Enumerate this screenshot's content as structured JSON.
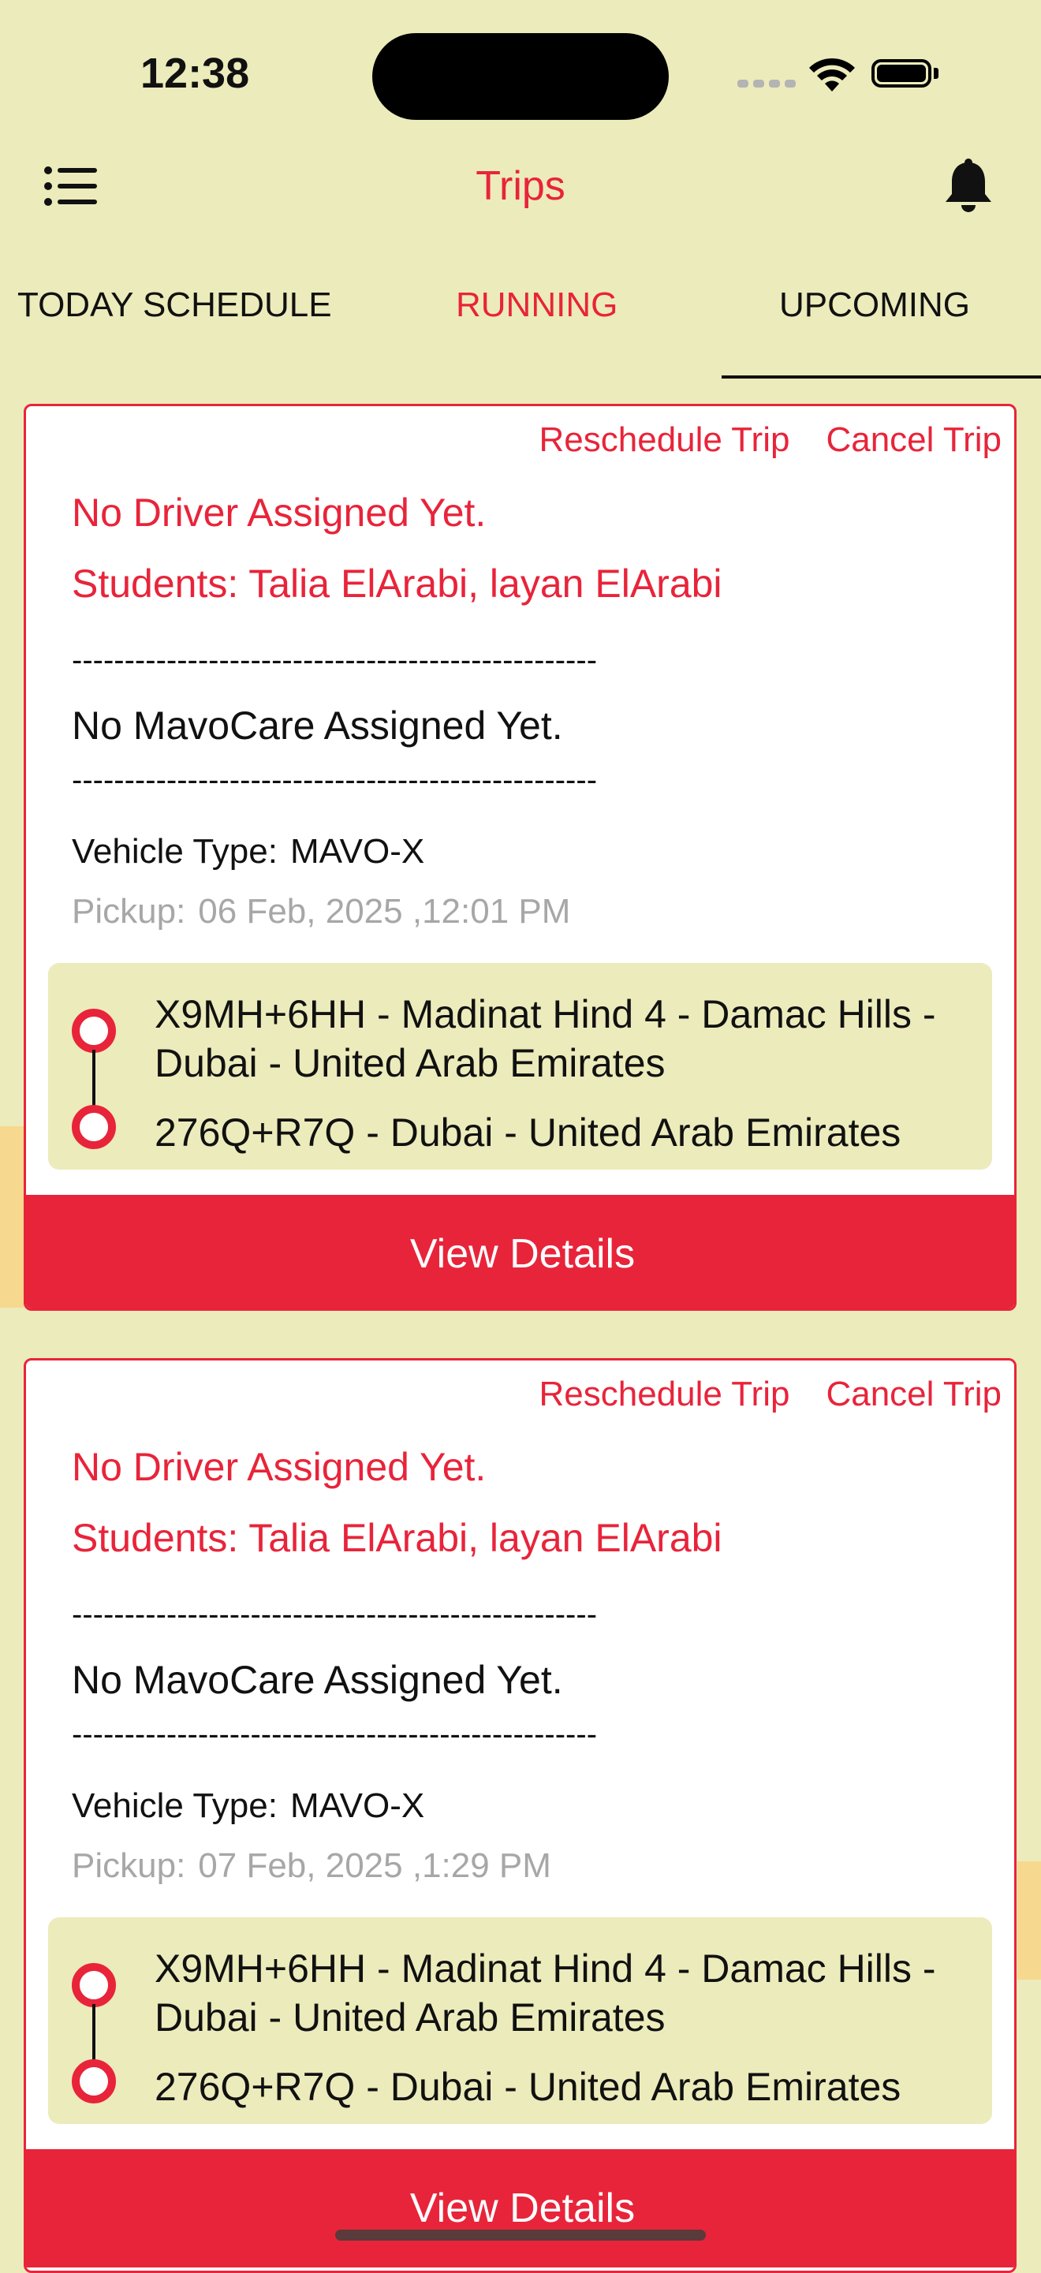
{
  "status_bar": {
    "time": "12:38"
  },
  "nav": {
    "title": "Trips",
    "menu_icon": "menu-list-icon",
    "bell_icon": "bell-icon"
  },
  "tabs": [
    {
      "label": "TODAY SCHEDULE",
      "selected": false
    },
    {
      "label": "RUNNING",
      "selected": false
    },
    {
      "label": "UPCOMING",
      "selected": true
    }
  ],
  "colors": {
    "accent": "#e8243a",
    "background": "#ecebbb",
    "card": "#ffffff"
  },
  "trips": [
    {
      "reschedule_label": "Reschedule Trip",
      "cancel_label": "Cancel Trip",
      "driver_status": "No Driver Assigned Yet.",
      "students": "Students: Talia ElArabi, layan ElArabi",
      "divider": "--------------------------------------------------",
      "mavocare_status": "No MavoCare Assigned Yet.",
      "vehicle_label": "Vehicle Type:",
      "vehicle_value": "MAVO-X",
      "pickup_label": "Pickup:",
      "pickup_value": "06 Feb, 2025 ,12:01 PM",
      "from": "X9MH+6HH - Madinat Hind 4 - Damac Hills - Dubai - United Arab Emirates",
      "to": "276Q+R7Q - Dubai - United Arab Emirates",
      "view_details_label": "View Details"
    },
    {
      "reschedule_label": "Reschedule Trip",
      "cancel_label": "Cancel Trip",
      "driver_status": "No Driver Assigned Yet.",
      "students": "Students: Talia ElArabi, layan ElArabi",
      "divider": "--------------------------------------------------",
      "mavocare_status": "No MavoCare Assigned Yet.",
      "vehicle_label": "Vehicle Type:",
      "vehicle_value": "MAVO-X",
      "pickup_label": "Pickup:",
      "pickup_value": "07 Feb, 2025 ,1:29 PM",
      "from": "X9MH+6HH - Madinat Hind 4 - Damac Hills - Dubai - United Arab Emirates",
      "to": "276Q+R7Q - Dubai - United Arab Emirates",
      "view_details_label": "View Details"
    }
  ]
}
